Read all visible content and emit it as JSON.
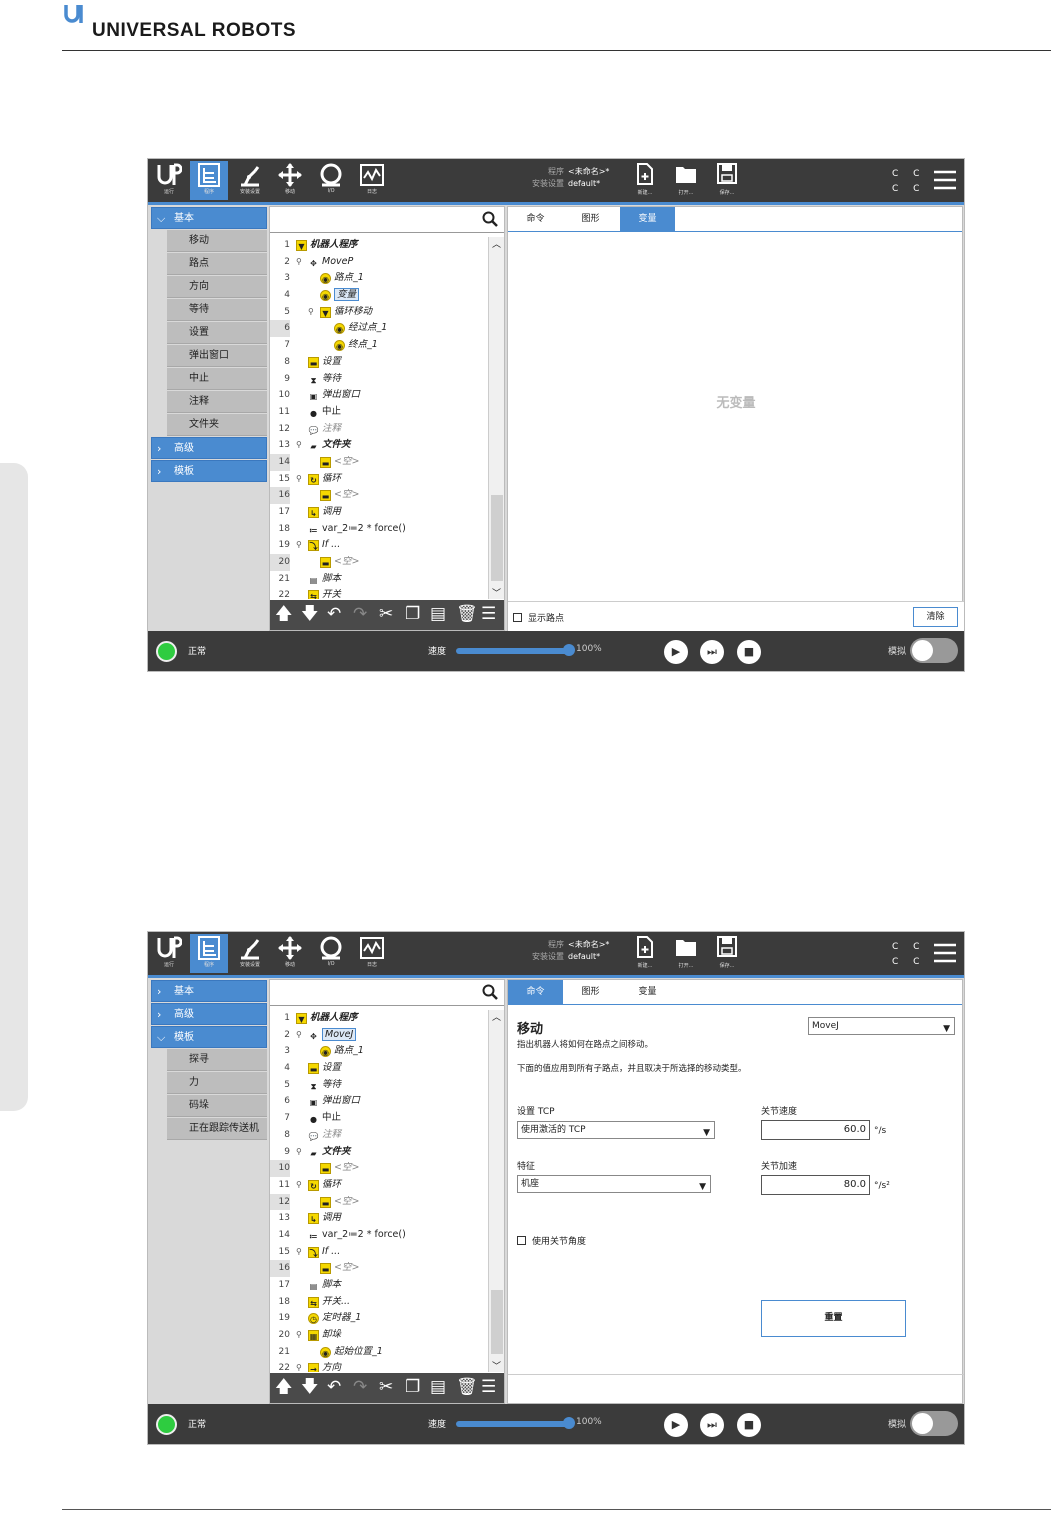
{
  "header": {
    "brand": "UNIVERSAL ROBOTS"
  },
  "nav": {
    "run": "运行",
    "program": "程序",
    "installation": "安装设置",
    "move": "移动",
    "io": "I/O",
    "log": "日志"
  },
  "top": {
    "program_label": "程序",
    "program_value": "<未命名>*",
    "install_label": "安装设置",
    "install_value": "default*",
    "new": "新建...",
    "open": "打开...",
    "save": "保存...",
    "cc": "C C"
  },
  "status": {
    "state": "正常",
    "speed_label": "速度",
    "speed_value": "100%",
    "speed_fraction": 1.0,
    "sim_label": "模拟"
  },
  "shot1": {
    "categories": [
      "基本",
      "高级",
      "模板"
    ],
    "basic_items": [
      "移动",
      "路点",
      "方向",
      "等待",
      "设置",
      "弹出窗口",
      "中止",
      "注释",
      "文件夹"
    ],
    "tree": [
      {
        "n": "1",
        "t": "机器人程序"
      },
      {
        "n": "2",
        "t": "MoveP"
      },
      {
        "n": "3",
        "t": "路点_1"
      },
      {
        "n": "4",
        "t": "变量"
      },
      {
        "n": "5",
        "t": "循环移动"
      },
      {
        "n": "6",
        "t": "经过点_1"
      },
      {
        "n": "7",
        "t": "终点_1"
      },
      {
        "n": "8",
        "t": "设置"
      },
      {
        "n": "9",
        "t": "等待"
      },
      {
        "n": "10",
        "t": "弹出窗口"
      },
      {
        "n": "11",
        "t": "中止"
      },
      {
        "n": "12",
        "t": "注释"
      },
      {
        "n": "13",
        "t": "文件夹"
      },
      {
        "n": "14",
        "t": "<空>"
      },
      {
        "n": "15",
        "t": "循环"
      },
      {
        "n": "16",
        "t": "<空>"
      },
      {
        "n": "17",
        "t": "调用"
      },
      {
        "n": "18",
        "t": "var_2≔2 * force()"
      },
      {
        "n": "19",
        "t": "If ..."
      },
      {
        "n": "20",
        "t": "<空>"
      },
      {
        "n": "21",
        "t": "脚本"
      },
      {
        "n": "22",
        "t": "开关"
      }
    ],
    "tabs": [
      "命令",
      "图形",
      "变量"
    ],
    "no_variables": "无变量",
    "show_waypoints": "显示路点",
    "clear": "清除"
  },
  "shot2": {
    "categories": [
      "基本",
      "高级",
      "模板"
    ],
    "template_items": [
      "探寻",
      "力",
      "码垛",
      "正在跟踪传送机"
    ],
    "tree": [
      {
        "n": "1",
        "t": "机器人程序"
      },
      {
        "n": "2",
        "t": "MoveJ"
      },
      {
        "n": "3",
        "t": "路点_1"
      },
      {
        "n": "4",
        "t": "设置"
      },
      {
        "n": "5",
        "t": "等待"
      },
      {
        "n": "6",
        "t": "弹出窗口"
      },
      {
        "n": "7",
        "t": "中止"
      },
      {
        "n": "8",
        "t": "注释"
      },
      {
        "n": "9",
        "t": "文件夹"
      },
      {
        "n": "10",
        "t": "<空>"
      },
      {
        "n": "11",
        "t": "循环"
      },
      {
        "n": "12",
        "t": "<空>"
      },
      {
        "n": "13",
        "t": "调用"
      },
      {
        "n": "14",
        "t": "var_2≔2 * force()"
      },
      {
        "n": "15",
        "t": "If ..."
      },
      {
        "n": "16",
        "t": "<空>"
      },
      {
        "n": "17",
        "t": "脚本"
      },
      {
        "n": "18",
        "t": "开关..."
      },
      {
        "n": "19",
        "t": "定时器_1"
      },
      {
        "n": "20",
        "t": "卸垛"
      },
      {
        "n": "21",
        "t": "起始位置_1"
      },
      {
        "n": "22",
        "t": "方向"
      }
    ],
    "tabs": [
      "命令",
      "图形",
      "变量"
    ],
    "title": "移动",
    "move_type": "MoveJ",
    "desc1": "指出机器人将如何在路点之间移动。",
    "desc2": "下面的值应用到所有子路点，并且取决于所选择的移动类型。",
    "tcp_label": "设置 TCP",
    "tcp_value": "使用激活的 TCP",
    "feature_label": "特征",
    "feature_value": "机座",
    "joint_speed_label": "关节速度",
    "joint_speed_value": "60.0",
    "joint_speed_unit": "°/s",
    "joint_acc_label": "关节加速",
    "joint_acc_value": "80.0",
    "joint_acc_unit": "°/s²",
    "use_joint_angles": "使用关节角度",
    "reset": "重置"
  }
}
